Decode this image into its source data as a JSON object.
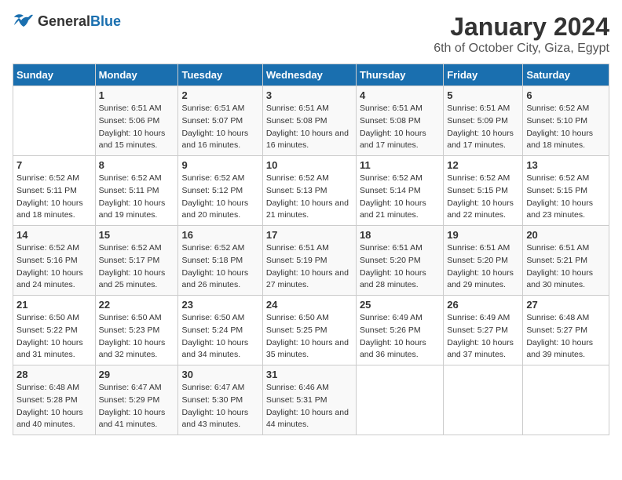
{
  "logo": {
    "text_general": "General",
    "text_blue": "Blue"
  },
  "title": "January 2024",
  "subtitle": "6th of October City, Giza, Egypt",
  "headers": [
    "Sunday",
    "Monday",
    "Tuesday",
    "Wednesday",
    "Thursday",
    "Friday",
    "Saturday"
  ],
  "weeks": [
    [
      {
        "day": "",
        "sunrise": "",
        "sunset": "",
        "daylight": ""
      },
      {
        "day": "1",
        "sunrise": "Sunrise: 6:51 AM",
        "sunset": "Sunset: 5:06 PM",
        "daylight": "Daylight: 10 hours and 15 minutes."
      },
      {
        "day": "2",
        "sunrise": "Sunrise: 6:51 AM",
        "sunset": "Sunset: 5:07 PM",
        "daylight": "Daylight: 10 hours and 16 minutes."
      },
      {
        "day": "3",
        "sunrise": "Sunrise: 6:51 AM",
        "sunset": "Sunset: 5:08 PM",
        "daylight": "Daylight: 10 hours and 16 minutes."
      },
      {
        "day": "4",
        "sunrise": "Sunrise: 6:51 AM",
        "sunset": "Sunset: 5:08 PM",
        "daylight": "Daylight: 10 hours and 17 minutes."
      },
      {
        "day": "5",
        "sunrise": "Sunrise: 6:51 AM",
        "sunset": "Sunset: 5:09 PM",
        "daylight": "Daylight: 10 hours and 17 minutes."
      },
      {
        "day": "6",
        "sunrise": "Sunrise: 6:52 AM",
        "sunset": "Sunset: 5:10 PM",
        "daylight": "Daylight: 10 hours and 18 minutes."
      }
    ],
    [
      {
        "day": "7",
        "sunrise": "Sunrise: 6:52 AM",
        "sunset": "Sunset: 5:11 PM",
        "daylight": "Daylight: 10 hours and 18 minutes."
      },
      {
        "day": "8",
        "sunrise": "Sunrise: 6:52 AM",
        "sunset": "Sunset: 5:11 PM",
        "daylight": "Daylight: 10 hours and 19 minutes."
      },
      {
        "day": "9",
        "sunrise": "Sunrise: 6:52 AM",
        "sunset": "Sunset: 5:12 PM",
        "daylight": "Daylight: 10 hours and 20 minutes."
      },
      {
        "day": "10",
        "sunrise": "Sunrise: 6:52 AM",
        "sunset": "Sunset: 5:13 PM",
        "daylight": "Daylight: 10 hours and 21 minutes."
      },
      {
        "day": "11",
        "sunrise": "Sunrise: 6:52 AM",
        "sunset": "Sunset: 5:14 PM",
        "daylight": "Daylight: 10 hours and 21 minutes."
      },
      {
        "day": "12",
        "sunrise": "Sunrise: 6:52 AM",
        "sunset": "Sunset: 5:15 PM",
        "daylight": "Daylight: 10 hours and 22 minutes."
      },
      {
        "day": "13",
        "sunrise": "Sunrise: 6:52 AM",
        "sunset": "Sunset: 5:15 PM",
        "daylight": "Daylight: 10 hours and 23 minutes."
      }
    ],
    [
      {
        "day": "14",
        "sunrise": "Sunrise: 6:52 AM",
        "sunset": "Sunset: 5:16 PM",
        "daylight": "Daylight: 10 hours and 24 minutes."
      },
      {
        "day": "15",
        "sunrise": "Sunrise: 6:52 AM",
        "sunset": "Sunset: 5:17 PM",
        "daylight": "Daylight: 10 hours and 25 minutes."
      },
      {
        "day": "16",
        "sunrise": "Sunrise: 6:52 AM",
        "sunset": "Sunset: 5:18 PM",
        "daylight": "Daylight: 10 hours and 26 minutes."
      },
      {
        "day": "17",
        "sunrise": "Sunrise: 6:51 AM",
        "sunset": "Sunset: 5:19 PM",
        "daylight": "Daylight: 10 hours and 27 minutes."
      },
      {
        "day": "18",
        "sunrise": "Sunrise: 6:51 AM",
        "sunset": "Sunset: 5:20 PM",
        "daylight": "Daylight: 10 hours and 28 minutes."
      },
      {
        "day": "19",
        "sunrise": "Sunrise: 6:51 AM",
        "sunset": "Sunset: 5:20 PM",
        "daylight": "Daylight: 10 hours and 29 minutes."
      },
      {
        "day": "20",
        "sunrise": "Sunrise: 6:51 AM",
        "sunset": "Sunset: 5:21 PM",
        "daylight": "Daylight: 10 hours and 30 minutes."
      }
    ],
    [
      {
        "day": "21",
        "sunrise": "Sunrise: 6:50 AM",
        "sunset": "Sunset: 5:22 PM",
        "daylight": "Daylight: 10 hours and 31 minutes."
      },
      {
        "day": "22",
        "sunrise": "Sunrise: 6:50 AM",
        "sunset": "Sunset: 5:23 PM",
        "daylight": "Daylight: 10 hours and 32 minutes."
      },
      {
        "day": "23",
        "sunrise": "Sunrise: 6:50 AM",
        "sunset": "Sunset: 5:24 PM",
        "daylight": "Daylight: 10 hours and 34 minutes."
      },
      {
        "day": "24",
        "sunrise": "Sunrise: 6:50 AM",
        "sunset": "Sunset: 5:25 PM",
        "daylight": "Daylight: 10 hours and 35 minutes."
      },
      {
        "day": "25",
        "sunrise": "Sunrise: 6:49 AM",
        "sunset": "Sunset: 5:26 PM",
        "daylight": "Daylight: 10 hours and 36 minutes."
      },
      {
        "day": "26",
        "sunrise": "Sunrise: 6:49 AM",
        "sunset": "Sunset: 5:27 PM",
        "daylight": "Daylight: 10 hours and 37 minutes."
      },
      {
        "day": "27",
        "sunrise": "Sunrise: 6:48 AM",
        "sunset": "Sunset: 5:27 PM",
        "daylight": "Daylight: 10 hours and 39 minutes."
      }
    ],
    [
      {
        "day": "28",
        "sunrise": "Sunrise: 6:48 AM",
        "sunset": "Sunset: 5:28 PM",
        "daylight": "Daylight: 10 hours and 40 minutes."
      },
      {
        "day": "29",
        "sunrise": "Sunrise: 6:47 AM",
        "sunset": "Sunset: 5:29 PM",
        "daylight": "Daylight: 10 hours and 41 minutes."
      },
      {
        "day": "30",
        "sunrise": "Sunrise: 6:47 AM",
        "sunset": "Sunset: 5:30 PM",
        "daylight": "Daylight: 10 hours and 43 minutes."
      },
      {
        "day": "31",
        "sunrise": "Sunrise: 6:46 AM",
        "sunset": "Sunset: 5:31 PM",
        "daylight": "Daylight: 10 hours and 44 minutes."
      },
      {
        "day": "",
        "sunrise": "",
        "sunset": "",
        "daylight": ""
      },
      {
        "day": "",
        "sunrise": "",
        "sunset": "",
        "daylight": ""
      },
      {
        "day": "",
        "sunrise": "",
        "sunset": "",
        "daylight": ""
      }
    ]
  ]
}
